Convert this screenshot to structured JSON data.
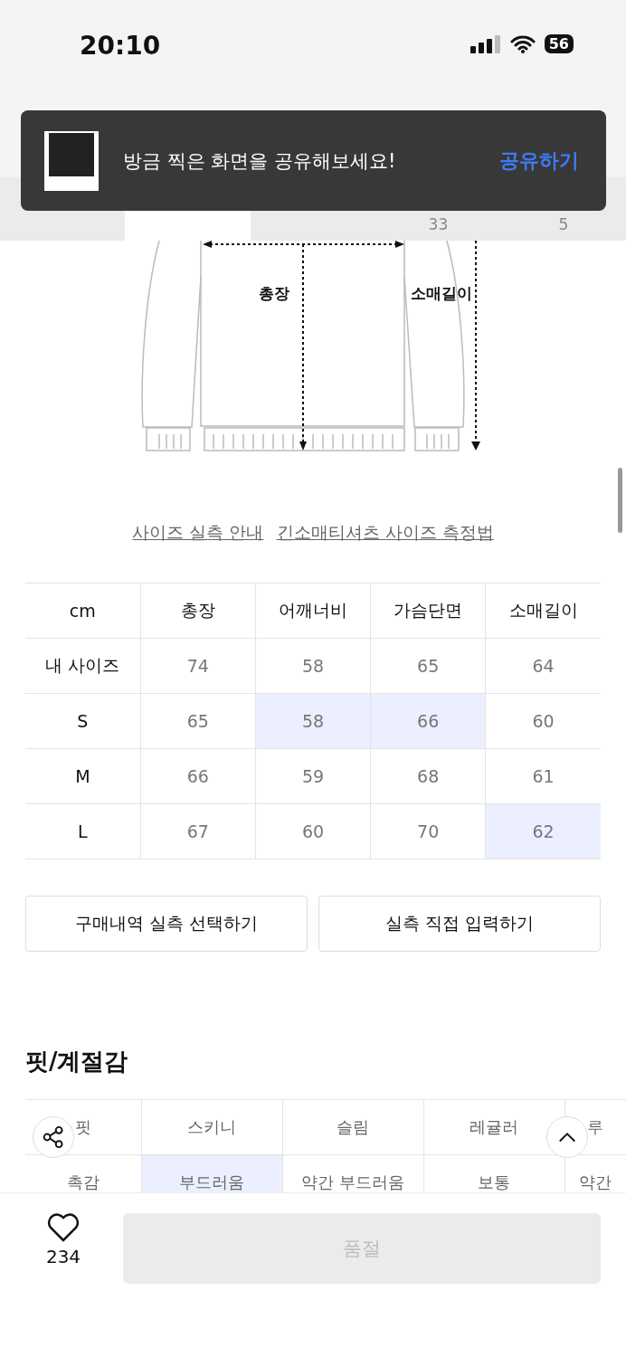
{
  "status_bar": {
    "time": "20:10",
    "battery": "56"
  },
  "tabs": [
    {
      "selected": false
    },
    {
      "selected": true
    },
    {
      "selected": false
    },
    {
      "count": "33",
      "selected": false
    },
    {
      "count": "5",
      "selected": false
    }
  ],
  "toast": {
    "message": "방금 찍은 화면을 공유해보세요!",
    "action": "공유하기"
  },
  "diagram": {
    "length_label": "총장",
    "sleeve_label": "소매길이"
  },
  "links": [
    "사이즈 실측 안내",
    "긴소매티셔츠 사이즈 측정법"
  ],
  "size_table": {
    "corner": "cm",
    "columns": [
      "총장",
      "어깨너비",
      "가슴단면",
      "소매길이"
    ],
    "rows": [
      {
        "label": "내 사이즈",
        "cells": [
          {
            "value": "74",
            "selected": false
          },
          {
            "value": "58",
            "selected": false
          },
          {
            "value": "65",
            "selected": false
          },
          {
            "value": "64",
            "selected": false
          }
        ]
      },
      {
        "label": "S",
        "cells": [
          {
            "value": "65",
            "selected": false
          },
          {
            "value": "58",
            "selected": true
          },
          {
            "value": "66",
            "selected": true
          },
          {
            "value": "60",
            "selected": false
          }
        ]
      },
      {
        "label": "M",
        "cells": [
          {
            "value": "66",
            "selected": false
          },
          {
            "value": "59",
            "selected": false
          },
          {
            "value": "68",
            "selected": false
          },
          {
            "value": "61",
            "selected": false
          }
        ]
      },
      {
        "label": "L",
        "cells": [
          {
            "value": "67",
            "selected": false
          },
          {
            "value": "60",
            "selected": false
          },
          {
            "value": "70",
            "selected": false
          },
          {
            "value": "62",
            "selected": true
          }
        ]
      }
    ]
  },
  "buttons": [
    "구매내역 실측 선택하기",
    "실측 직접 입력하기"
  ],
  "fit_section": {
    "title": "핏/계절감",
    "rows": [
      {
        "label": "핏",
        "cells": [
          {
            "value": "스키니",
            "selected": false
          },
          {
            "value": "슬림",
            "selected": false
          },
          {
            "value": "레귤러",
            "selected": false
          },
          {
            "value": "루",
            "selected": false
          }
        ]
      },
      {
        "label": "촉감",
        "cells": [
          {
            "value": "부드러움",
            "selected": true
          },
          {
            "value": "약간 부드러움",
            "selected": false
          },
          {
            "value": "보통",
            "selected": false
          },
          {
            "value": "약간",
            "selected": false
          }
        ]
      }
    ]
  },
  "bottom_bar": {
    "likes": "234",
    "buy_button": "품절",
    "buy_disabled": true
  }
}
